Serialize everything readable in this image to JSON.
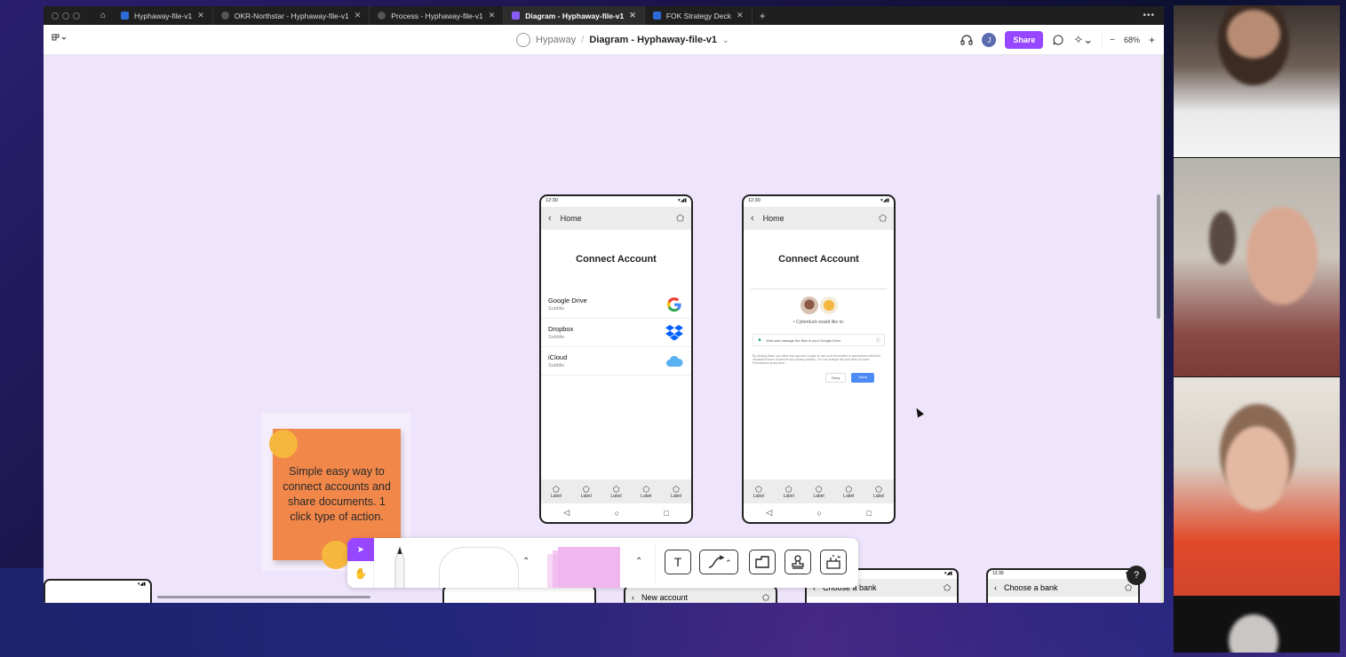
{
  "tabs": [
    {
      "label": "Hyphaway-file-v1",
      "icon": "figma-file-icon",
      "active": false
    },
    {
      "label": "OKR-Northstar - Hyphaway-file-v1",
      "icon": "prototype-icon",
      "active": false
    },
    {
      "label": "Process - Hyphaway-file-v1",
      "icon": "prototype-icon",
      "active": false
    },
    {
      "label": "Diagram - Hyphaway-file-v1",
      "icon": "figjam-file-icon",
      "active": true
    },
    {
      "label": "FOK Strategy Deck",
      "icon": "figma-file-icon",
      "active": false
    }
  ],
  "toolbar": {
    "team": "Hypaway",
    "separator": "/",
    "file": "Diagram - Hyphaway-file-v1",
    "avatar_initial": "J",
    "share_label": "Share",
    "zoom": "68%",
    "zoom_out": "−",
    "zoom_in": "+"
  },
  "phone_a": {
    "time": "12:30",
    "header": "Home",
    "title": "Connect Account",
    "accounts": [
      {
        "name": "Google Drive",
        "subtitle": "Subtitle",
        "logo": "google-drive-logo"
      },
      {
        "name": "Dropbox",
        "subtitle": "Subtitle",
        "logo": "dropbox-logo"
      },
      {
        "name": "iCloud",
        "subtitle": "Subtitle",
        "logo": "icloud-logo"
      }
    ],
    "nav_label": "Label"
  },
  "phone_b": {
    "time": "12:30",
    "header": "Home",
    "title": "Connect Account",
    "consent_line": "• Cyberduck would like to:",
    "permission": "View and manage the files in your Google Drive",
    "fine_print": "By clicking Allow, you allow this app and Google to use your information in accordance with their respective terms of service and privacy policies. You can change this and other Account Permissions at any time.",
    "deny": "Deny",
    "allow": "Allow",
    "nav_label": "Label"
  },
  "sticky_note": {
    "text": "Simple easy way to connect accounts and share documents.  1 click type of action."
  },
  "peek_frames": [
    {
      "time": "",
      "header": "New account"
    },
    {
      "time": "",
      "header": "Choose a bank"
    },
    {
      "time": "12:30",
      "header": "Choose a bank"
    }
  ],
  "help": "?",
  "colors": {
    "canvas": "#eee4fb",
    "accent": "#9747ff",
    "sticky": "#f2874a",
    "sticky_dot": "#f6b73c"
  }
}
